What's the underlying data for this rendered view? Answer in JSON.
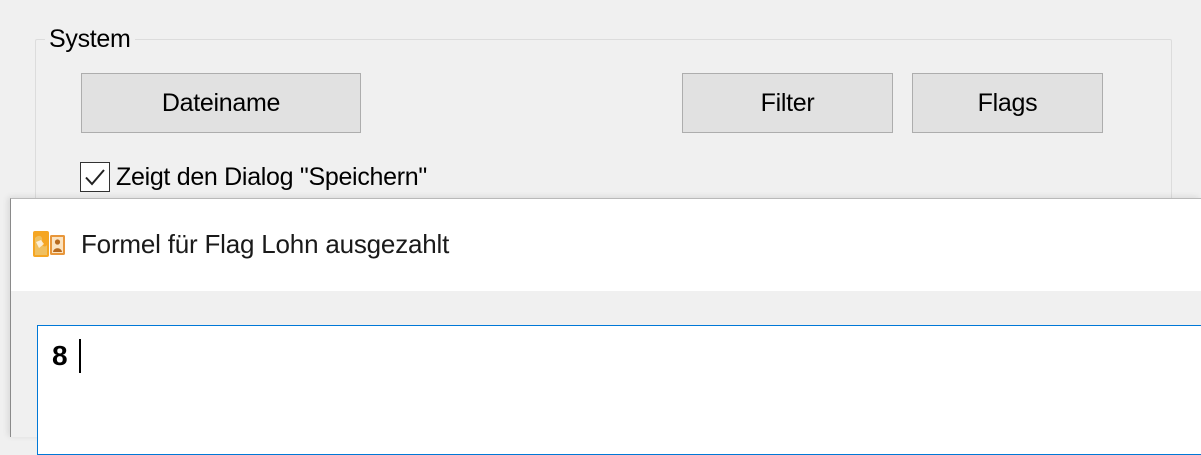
{
  "system_group": {
    "legend": "System",
    "buttons": {
      "dateiname": "Dateiname",
      "filter": "Filter",
      "flags": "Flags"
    },
    "checkbox": {
      "label": "Zeigt den Dialog \"Speichern\"",
      "checked": true
    }
  },
  "dialog": {
    "title": "Formel für Flag Lohn ausgezahlt",
    "icon": "app-icon",
    "formula_value": "8"
  },
  "colors": {
    "window_bg": "#f0f0f0",
    "button_bg": "#e1e1e1",
    "input_focus_border": "#0078d7"
  }
}
